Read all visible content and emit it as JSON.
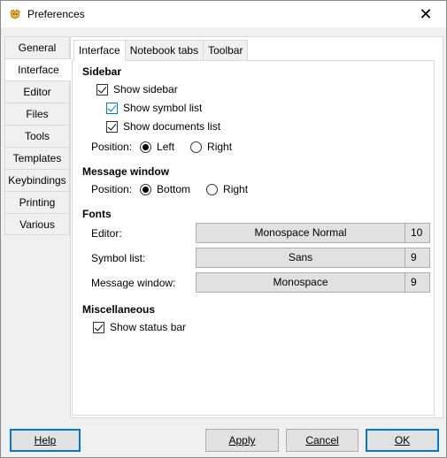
{
  "window": {
    "title": "Preferences",
    "close_glyph": "✕"
  },
  "left_tabs": [
    {
      "label": "General"
    },
    {
      "label": "Interface"
    },
    {
      "label": "Editor"
    },
    {
      "label": "Files"
    },
    {
      "label": "Tools"
    },
    {
      "label": "Templates"
    },
    {
      "label": "Keybindings"
    },
    {
      "label": "Printing"
    },
    {
      "label": "Various"
    }
  ],
  "top_tabs": [
    {
      "label": "Interface"
    },
    {
      "label": "Notebook tabs"
    },
    {
      "label": "Toolbar"
    }
  ],
  "sidebar": {
    "title": "Sidebar",
    "show_sidebar": "Show sidebar",
    "show_symbol_list": "Show symbol list",
    "show_documents_list": "Show documents list",
    "position_label": "Position:",
    "left": "Left",
    "right": "Right"
  },
  "message_window": {
    "title": "Message window",
    "position_label": "Position:",
    "bottom": "Bottom",
    "right": "Right"
  },
  "fonts": {
    "title": "Fonts",
    "editor_label": "Editor:",
    "editor_font": "Monospace Normal",
    "editor_size": "10",
    "symbol_label": "Symbol list:",
    "symbol_font": "Sans",
    "symbol_size": "9",
    "message_label": "Message window:",
    "message_font": "Monospace",
    "message_size": "9"
  },
  "misc": {
    "title": "Miscellaneous",
    "show_status_bar": "Show status bar"
  },
  "buttons": {
    "help": "Help",
    "apply": "Apply",
    "cancel": "Cancel",
    "ok": "OK"
  }
}
